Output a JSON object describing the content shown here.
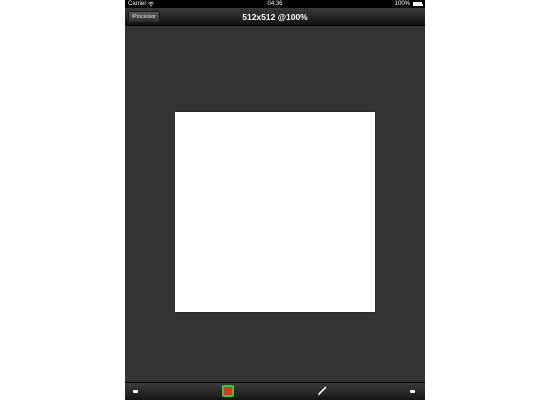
{
  "status_bar": {
    "carrier": "Carrier",
    "time": "04:36",
    "battery": "100%"
  },
  "nav_bar": {
    "back_label": "iProcessor",
    "title": "512x512 @100%"
  },
  "toolbar": {
    "color_swatch": {
      "fill": "#e03030",
      "border": "#2ccc2c"
    },
    "icons": [
      "minus-icon",
      "color-swatch",
      "brush-icon",
      "minus-icon"
    ]
  },
  "colors": {
    "background": "#333333",
    "canvas": "#ffffff"
  }
}
